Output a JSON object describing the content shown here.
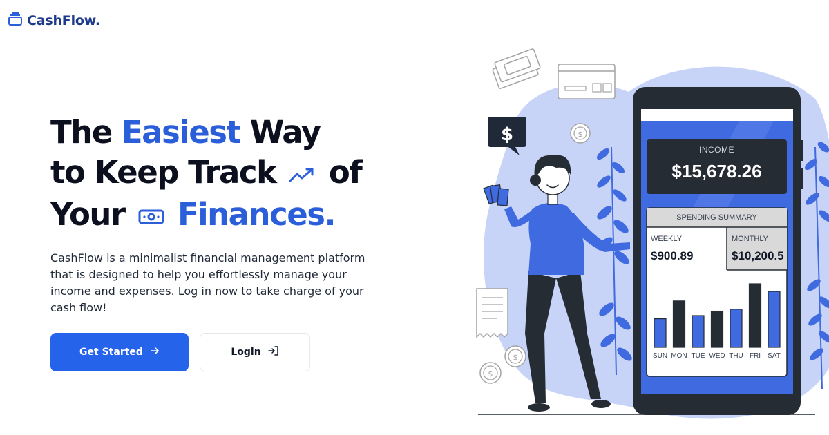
{
  "brand": {
    "name": "CashFlow.",
    "icon": "wallet-icon",
    "color": "#1e3a8a"
  },
  "hero": {
    "title_line1_a": "The ",
    "title_line1_accent": "Easiest",
    "title_line1_b": " Way",
    "title_line2_a": "to Keep Track",
    "title_line2_b": "of",
    "title_line3_a": "Your",
    "title_line3_accent": "Finances.",
    "description": "CashFlow is a minimalist financial management platform that is designed to help you effortlessly manage your income and expenses. Log in now to take charge of your cash flow!",
    "accent_color": "#2b5fd9"
  },
  "buttons": {
    "get_started": "Get Started",
    "login": "Login",
    "primary_color": "#2563eb"
  },
  "phone": {
    "income_label": "INCOME",
    "income_value": "$15,678.26",
    "spending_title": "SPENDING SUMMARY",
    "weekly_label": "WEEKLY",
    "weekly_value": "$900.89",
    "monthly_label": "MONTHLY",
    "monthly_value": "$10,200.5",
    "chart": {
      "days": [
        "SUN",
        "MON",
        "TUE",
        "WED",
        "THU",
        "FRI",
        "SAT"
      ],
      "heights": [
        0.45,
        0.73,
        0.5,
        0.57,
        0.6,
        1.0,
        0.88
      ],
      "colors": [
        "blue",
        "dark",
        "blue",
        "dark",
        "blue",
        "dark",
        "blue"
      ]
    }
  },
  "icons": [
    "wallet-icon",
    "trend-up-icon",
    "money-icon",
    "arrow-right-icon",
    "login-icon",
    "dollar-bubble-icon",
    "coin-icon",
    "credit-card-icon",
    "cash-icon",
    "receipt-icon",
    "leaf-icon"
  ]
}
